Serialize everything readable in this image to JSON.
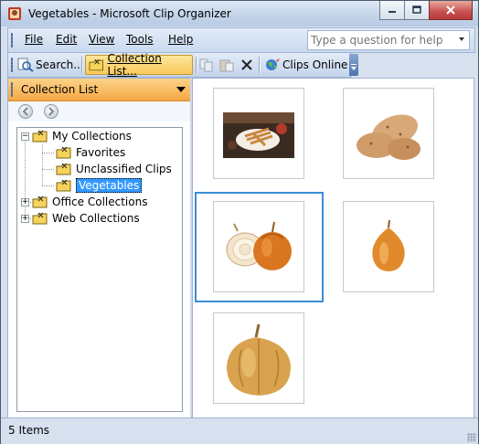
{
  "window": {
    "title": "Vegetables - Microsoft Clip Organizer"
  },
  "menu": {
    "file": "File",
    "edit": "Edit",
    "view": "View",
    "tools": "Tools",
    "help": "Help"
  },
  "help_box": {
    "placeholder": "Type a question for help"
  },
  "toolbar": {
    "search_label": "Search...",
    "collection_list_label": "Collection List...",
    "clips_online_label": "Clips Online"
  },
  "pane": {
    "title": "Collection List"
  },
  "tree": {
    "my_collections": "My Collections",
    "favorites": "Favorites",
    "unclassified": "Unclassified Clips",
    "vegetables": "Vegetables",
    "office": "Office Collections",
    "web": "Web Collections"
  },
  "clips": [
    {
      "name": "french-fries-clip"
    },
    {
      "name": "potatoes-clip"
    },
    {
      "name": "onions-clip"
    },
    {
      "name": "onion-clip"
    },
    {
      "name": "yellow-onion-clip"
    }
  ],
  "status": {
    "items": "5 Items"
  },
  "colors": {
    "accent": "#f6a844",
    "selection": "#3399ff",
    "frame": "#3a8ddb"
  }
}
